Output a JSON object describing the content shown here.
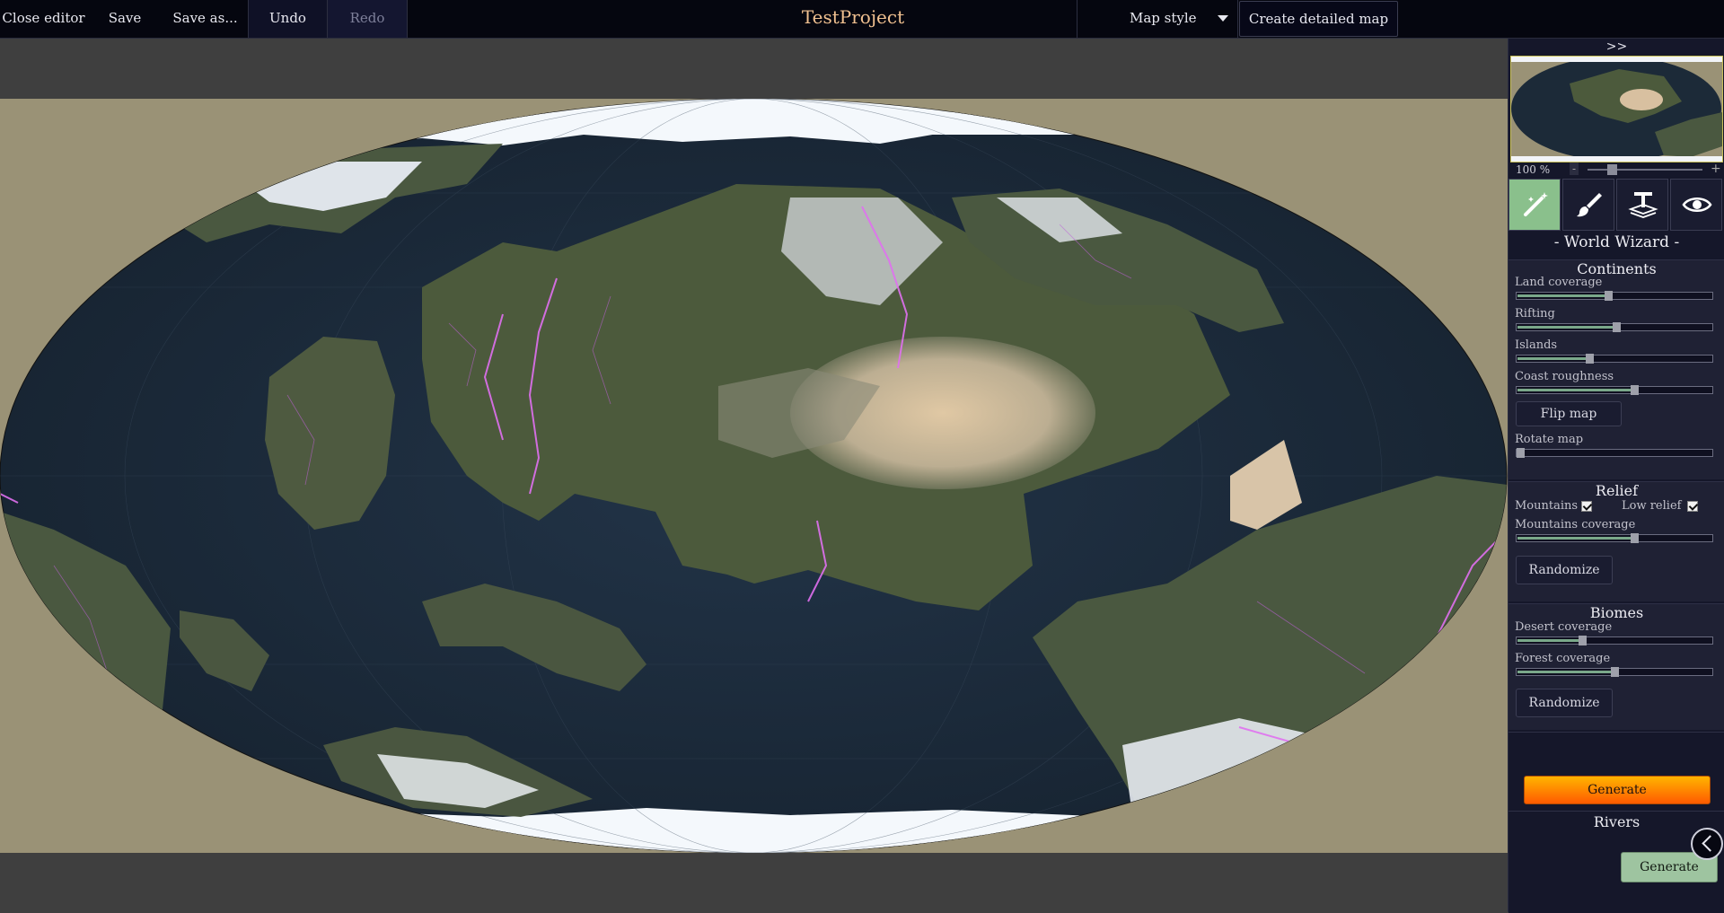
{
  "topbar": {
    "close_editor": "Close editor",
    "save": "Save",
    "save_as": "Save as...",
    "undo": "Undo",
    "redo": "Redo",
    "title": "TestProject",
    "map_style": "Map style",
    "create_detailed_map": "Create detailed map"
  },
  "panel": {
    "collapse": ">>",
    "zoom": "100 %",
    "zoom_minus": "-",
    "zoom_plus": "+",
    "zoom_level": 0.17,
    "tools": [
      {
        "name": "magic-wand-icon",
        "active": true
      },
      {
        "name": "brush-icon",
        "active": false
      },
      {
        "name": "text-layers-icon",
        "active": false
      },
      {
        "name": "eye-icon",
        "active": false
      }
    ],
    "wizard_title": "- World Wizard -",
    "continents": {
      "title": "Continents",
      "land_coverage": {
        "label": "Land coverage",
        "value": 0.47
      },
      "rifting": {
        "label": "Rifting",
        "value": 0.51
      },
      "islands": {
        "label": "Islands",
        "value": 0.37
      },
      "coast_roughness": {
        "label": "Coast roughness",
        "value": 0.61
      },
      "flip_map": "Flip map",
      "rotate_map": {
        "label": "Rotate map",
        "value": 0.0
      }
    },
    "relief": {
      "title": "Relief",
      "mountains": "Mountains",
      "low_relief": "Low relief",
      "mountains_checked": true,
      "low_relief_checked": true,
      "mountains_coverage": {
        "label": "Mountains coverage",
        "value": 0.61
      },
      "randomize": "Randomize"
    },
    "biomes": {
      "title": "Biomes",
      "desert_coverage": {
        "label": "Desert coverage",
        "value": 0.33
      },
      "forest_coverage": {
        "label": "Forest coverage",
        "value": 0.5
      },
      "randomize": "Randomize"
    },
    "generate": "Generate",
    "rivers": {
      "title": "Rivers",
      "generate": "Generate"
    }
  },
  "colors": {
    "topbar_bg": "#05060f",
    "title": "#f0c090",
    "panel_bg": "#15172a",
    "tool_active": "#8ac08c",
    "ocean": "#1a2a3c",
    "land": "#4c5a3c",
    "desert": "#d8c0a0",
    "ice": "#e8ecf2",
    "river": "#e070f0",
    "generate_top": "#ffb400",
    "generate_bottom": "#ff5a00"
  }
}
